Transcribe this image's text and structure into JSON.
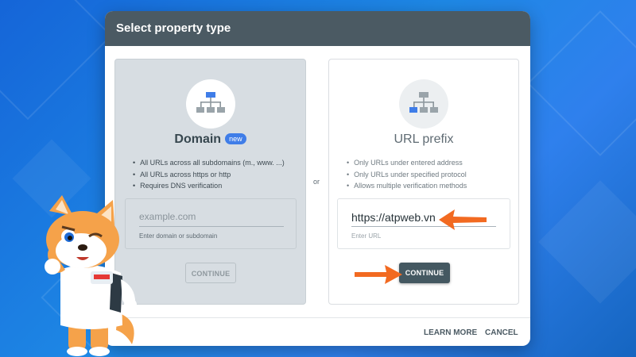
{
  "dialog": {
    "title": "Select property type",
    "or_label": "or",
    "learn_more": "LEARN MORE",
    "cancel": "CANCEL"
  },
  "domain": {
    "title": "Domain",
    "badge": "new",
    "bullets": [
      "All URLs across all subdomains (m., www. ...)",
      "All URLs across https or http",
      "Requires DNS verification"
    ],
    "input_placeholder": "example.com",
    "input_helper": "Enter domain or subdomain",
    "continue": "CONTINUE",
    "icon": "sitemap-icon"
  },
  "url_prefix": {
    "title": "URL prefix",
    "bullets": [
      "Only URLs under entered address",
      "Only URLs under specified protocol",
      "Allows multiple verification methods"
    ],
    "input_value": "https://atpweb.vn",
    "input_helper": "Enter URL",
    "continue": "CONTINUE",
    "icon": "sitemap-icon"
  },
  "colors": {
    "header": "#4b5a63",
    "badge": "#3f7de8",
    "arrow": "#f26a21",
    "button_dark": "#445861"
  }
}
